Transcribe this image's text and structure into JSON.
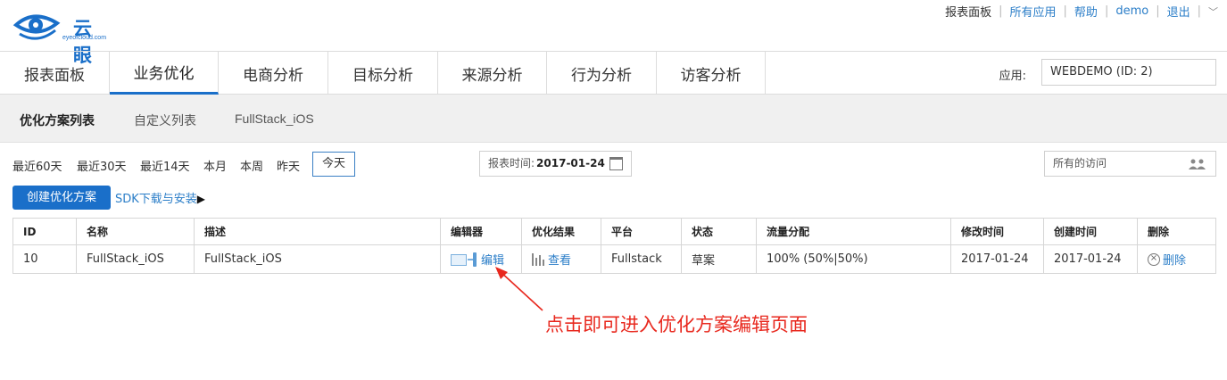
{
  "brand": {
    "name": "云眼",
    "sub": "eyeofcloud.com"
  },
  "top_links": [
    "报表面板",
    "所有应用",
    "帮助",
    "demo",
    "退出"
  ],
  "nav": {
    "items": [
      "报表面板",
      "业务优化",
      "电商分析",
      "目标分析",
      "来源分析",
      "行为分析",
      "访客分析"
    ],
    "active": "业务优化",
    "app_label": "应用:",
    "app_value": "WEBDEMO (ID: 2)"
  },
  "subnav": {
    "items": [
      "优化方案列表",
      "自定义列表",
      "FullStack_iOS"
    ],
    "active": "优化方案列表"
  },
  "filters": {
    "ranges": [
      "最近60天",
      "最近30天",
      "最近14天",
      "本月",
      "本周",
      "昨天",
      "今天"
    ],
    "selected": "今天",
    "report_time_label": "报表时间:",
    "report_time_value": "2017-01-24",
    "visits": "所有的访问"
  },
  "actions": {
    "create": "创建优化方案",
    "sdk": "SDK下载与安装",
    "sdk_arrow": "▶"
  },
  "table": {
    "headers": [
      "ID",
      "名称",
      "描述",
      "编辑器",
      "优化结果",
      "平台",
      "状态",
      "流量分配",
      "修改时间",
      "创建时间",
      "删除"
    ],
    "rows": [
      {
        "id": "10",
        "name": "FullStack_iOS",
        "desc": "FullStack_iOS",
        "editor": "编辑",
        "result": "查看",
        "platform": "Fullstack",
        "status": "草案",
        "traffic": "100% (50%|50%)",
        "modified": "2017-01-24",
        "created": "2017-01-24",
        "delete": "删除"
      }
    ]
  },
  "annotation": "点击即可进入优化方案编辑页面",
  "colors": {
    "accent": "#1a6fc9",
    "link": "#2b7ec8",
    "annotation": "#e8281e"
  }
}
